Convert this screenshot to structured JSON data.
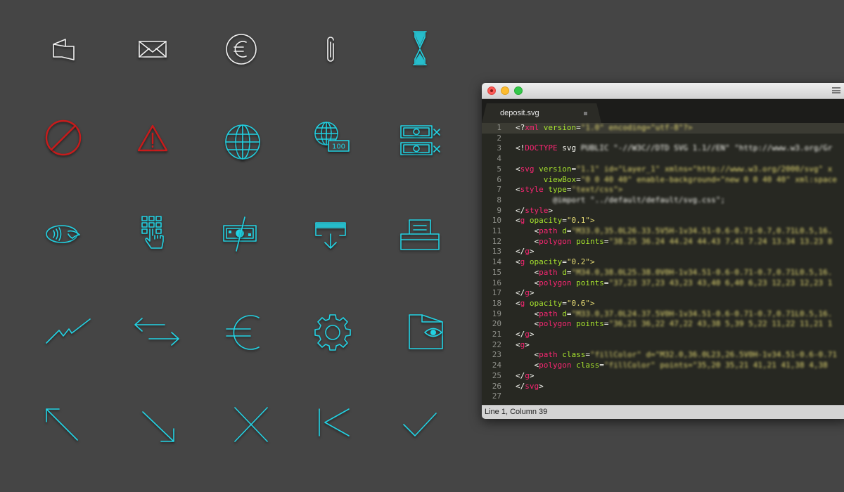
{
  "icon_grid": {
    "colors": {
      "cyan": "#22d3e4",
      "white": "#f2f2f2",
      "red": "#c91b1b"
    },
    "icons": [
      "wallet-icon",
      "envelope-icon",
      "euro-circle-icon",
      "paperclip-icon",
      "hourglass-icon",
      "prohibited-icon",
      "warning-icon",
      "globe-icon",
      "globe-100-icon",
      "banknotes-cancel-icon",
      "contactless-payment-icon",
      "keypad-hand-icon",
      "currency-exchange-icon",
      "card-deposit-icon",
      "receipt-printer-icon",
      "trend-line-icon",
      "transfer-arrows-icon",
      "euro-sign-icon",
      "gear-icon",
      "wallet-eye-icon",
      "arrow-up-left-icon",
      "arrow-down-right-icon",
      "close-icon",
      "skip-back-icon",
      "checkmark-icon"
    ],
    "globe_badge": "100"
  },
  "editor": {
    "tab_title": "deposit.svg",
    "status": "Line 1, Column 39",
    "colors": {
      "tag": "#f92672",
      "attr": "#a6e22e",
      "string": "#e6db74",
      "text": "#f8f8f2"
    },
    "lines": [
      {
        "n": "1",
        "tokens": [
          [
            "tx",
            "<?"
          ],
          [
            "tg",
            "xml"
          ],
          [
            "tx",
            " "
          ],
          [
            "at",
            "version"
          ],
          [
            "tx",
            "="
          ],
          [
            "st",
            "\"1.0\" encoding=\"utf-8\"?>"
          ]
        ]
      },
      {
        "n": "2",
        "tokens": []
      },
      {
        "n": "3",
        "tokens": [
          [
            "tx",
            "<!"
          ],
          [
            "tg",
            "DOCTYPE"
          ],
          [
            "tx",
            " svg "
          ],
          [
            "tx",
            "PUBLIC \"-//W3C//DTD SVG 1.1//EN\" \"http://www.w3.org/Gr"
          ]
        ]
      },
      {
        "n": "4",
        "tokens": []
      },
      {
        "n": "5",
        "tokens": [
          [
            "tx",
            "<"
          ],
          [
            "tg",
            "svg"
          ],
          [
            "tx",
            " "
          ],
          [
            "at",
            "version"
          ],
          [
            "tx",
            "="
          ],
          [
            "st",
            "\"1.1\" id=\"Layer_1\" xmlns=\"http://www.w3.org/2000/svg\" x"
          ]
        ]
      },
      {
        "n": "6",
        "tokens": [
          [
            "tx",
            "      "
          ],
          [
            "at",
            "viewBox"
          ],
          [
            "tx",
            "="
          ],
          [
            "st",
            "\"0 0 40 40\" enable-background=\"new 0 0 40 40\" xml:space"
          ]
        ]
      },
      {
        "n": "7",
        "tokens": [
          [
            "tx",
            "<"
          ],
          [
            "tg",
            "style"
          ],
          [
            "tx",
            " "
          ],
          [
            "at",
            "type"
          ],
          [
            "tx",
            "="
          ],
          [
            "st",
            "\"text/css\">"
          ]
        ]
      },
      {
        "n": "8",
        "tokens": [
          [
            "tx",
            "        @import \"../default/default/svg.css\";"
          ]
        ]
      },
      {
        "n": "9",
        "tokens": [
          [
            "tx",
            "</"
          ],
          [
            "tg",
            "style"
          ],
          [
            "tx",
            ">"
          ]
        ]
      },
      {
        "n": "10",
        "tokens": [
          [
            "tx",
            "<"
          ],
          [
            "tg",
            "g"
          ],
          [
            "tx",
            " "
          ],
          [
            "at",
            "opacity"
          ],
          [
            "tx",
            "="
          ],
          [
            "st",
            "\"0.1\">"
          ]
        ]
      },
      {
        "n": "11",
        "tokens": [
          [
            "tx",
            "    <"
          ],
          [
            "tg",
            "path"
          ],
          [
            "tx",
            " "
          ],
          [
            "at",
            "d"
          ],
          [
            "tx",
            "="
          ],
          [
            "st",
            "\"M33.0,35.0L26.33.5V5H-1v34.51-0.6-0.71-0.7,0.71L0.5,16."
          ]
        ]
      },
      {
        "n": "12",
        "tokens": [
          [
            "tx",
            "    <"
          ],
          [
            "tg",
            "polygon"
          ],
          [
            "tx",
            " "
          ],
          [
            "at",
            "points"
          ],
          [
            "tx",
            "="
          ],
          [
            "st",
            "\"38.25 36.24 44.24 44.43 7.41 7.24 13.34 13.23 8"
          ]
        ]
      },
      {
        "n": "13",
        "tokens": [
          [
            "tx",
            "</"
          ],
          [
            "tg",
            "g"
          ],
          [
            "tx",
            ">"
          ]
        ]
      },
      {
        "n": "14",
        "tokens": [
          [
            "tx",
            "<"
          ],
          [
            "tg",
            "g"
          ],
          [
            "tx",
            " "
          ],
          [
            "at",
            "opacity"
          ],
          [
            "tx",
            "="
          ],
          [
            "st",
            "\"0.2\">"
          ]
        ]
      },
      {
        "n": "15",
        "tokens": [
          [
            "tx",
            "    <"
          ],
          [
            "tg",
            "path"
          ],
          [
            "tx",
            " "
          ],
          [
            "at",
            "d"
          ],
          [
            "tx",
            "="
          ],
          [
            "st",
            "\"M34.0,38.0L25.38.0V0H-1v34.51-0.6-0.71-0.7,0.71L0.5,16."
          ]
        ]
      },
      {
        "n": "16",
        "tokens": [
          [
            "tx",
            "    <"
          ],
          [
            "tg",
            "polygon"
          ],
          [
            "tx",
            " "
          ],
          [
            "at",
            "points"
          ],
          [
            "tx",
            "="
          ],
          [
            "st",
            "\"37,23 37,23 43,23 43,40 6,40 6,23 12,23 12,23 1"
          ]
        ]
      },
      {
        "n": "17",
        "tokens": [
          [
            "tx",
            "</"
          ],
          [
            "tg",
            "g"
          ],
          [
            "tx",
            ">"
          ]
        ]
      },
      {
        "n": "18",
        "tokens": [
          [
            "tx",
            "<"
          ],
          [
            "tg",
            "g"
          ],
          [
            "tx",
            " "
          ],
          [
            "at",
            "opacity"
          ],
          [
            "tx",
            "="
          ],
          [
            "st",
            "\"0.6\">"
          ]
        ]
      },
      {
        "n": "19",
        "tokens": [
          [
            "tx",
            "    <"
          ],
          [
            "tg",
            "path"
          ],
          [
            "tx",
            " "
          ],
          [
            "at",
            "d"
          ],
          [
            "tx",
            "="
          ],
          [
            "st",
            "\"M33.0,37.0L24.37.5V0H-1v34.51-0.6-0.71-0.7,0.71L0.5,16."
          ]
        ]
      },
      {
        "n": "20",
        "tokens": [
          [
            "tx",
            "    <"
          ],
          [
            "tg",
            "polygon"
          ],
          [
            "tx",
            " "
          ],
          [
            "at",
            "points"
          ],
          [
            "tx",
            "="
          ],
          [
            "st",
            "\"36,21 36,22 47,22 43,38 5,39 5,22 11,22 11,21 1"
          ]
        ]
      },
      {
        "n": "21",
        "tokens": [
          [
            "tx",
            "</"
          ],
          [
            "tg",
            "g"
          ],
          [
            "tx",
            ">"
          ]
        ]
      },
      {
        "n": "22",
        "tokens": [
          [
            "tx",
            "<"
          ],
          [
            "tg",
            "g"
          ],
          [
            "tx",
            ">"
          ]
        ]
      },
      {
        "n": "23",
        "tokens": [
          [
            "tx",
            "    <"
          ],
          [
            "tg",
            "path"
          ],
          [
            "tx",
            " "
          ],
          [
            "at",
            "class"
          ],
          [
            "tx",
            "="
          ],
          [
            "st",
            "\"fillColor\" d=\"M32.0,36.0L23,26.5V0H-1v34.51-0.6-0.71"
          ]
        ]
      },
      {
        "n": "24",
        "tokens": [
          [
            "tx",
            "    <"
          ],
          [
            "tg",
            "polygon"
          ],
          [
            "tx",
            " "
          ],
          [
            "at",
            "class"
          ],
          [
            "tx",
            "="
          ],
          [
            "st",
            "\"fillColor\" points=\"35,20 35,21 41,21 41,38 4,38"
          ]
        ]
      },
      {
        "n": "25",
        "tokens": [
          [
            "tx",
            "</"
          ],
          [
            "tg",
            "g"
          ],
          [
            "tx",
            ">"
          ]
        ]
      },
      {
        "n": "26",
        "tokens": [
          [
            "tx",
            "</"
          ],
          [
            "tg",
            "svg"
          ],
          [
            "tx",
            ">"
          ]
        ]
      },
      {
        "n": "27",
        "tokens": []
      }
    ]
  }
}
